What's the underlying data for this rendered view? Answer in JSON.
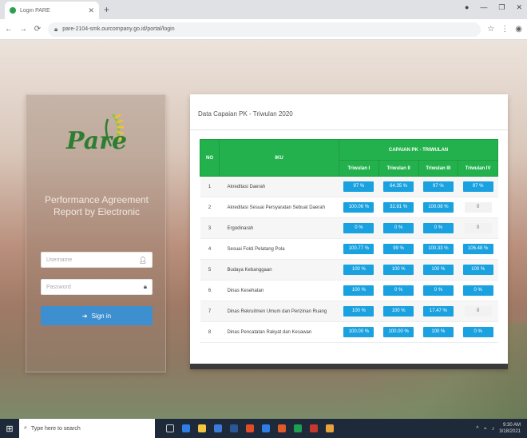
{
  "browser": {
    "tab_title": "Login PARE",
    "url": "pare-2104-smk.ourcompany.go.id/portal/login"
  },
  "login": {
    "logo_text": "Pare",
    "tagline": "Performance Agreement Report by Electronic",
    "username_placeholder": "Username",
    "password_placeholder": "Password",
    "signin_label": "Sign in"
  },
  "data": {
    "title": "Data Capaian PK - Triwulan 2020",
    "headers": {
      "no": "NO",
      "indicator": "IKU",
      "group": "CAPAIAN PK - TRIWULAN",
      "quarters": [
        "Triwulan I",
        "Triwulan II",
        "Triwulan III",
        "Triwulan IV"
      ]
    },
    "rows": [
      {
        "no": "1",
        "indicator": "Akreditasi Daerah",
        "q": [
          "97 %",
          "64.35 %",
          "97 %",
          "97 %"
        ]
      },
      {
        "no": "2",
        "indicator": "Akreditasi Sesuai Persyaratan Sebuat Daerah",
        "q": [
          "100.06 %",
          "32.81 %",
          "100.08 %",
          "0"
        ]
      },
      {
        "no": "3",
        "indicator": "Ergodinarah",
        "q": [
          "0 %",
          "0 %",
          "0 %",
          "0"
        ]
      },
      {
        "no": "4",
        "indicator": "Sesuai Fokti Pelatang Pola",
        "q": [
          "100.77 %",
          "99 %",
          "100.33 %",
          "106.48 %"
        ]
      },
      {
        "no": "5",
        "indicator": "Budaya Kebanggaan",
        "q": [
          "100 %",
          "100 %",
          "100 %",
          "100 %"
        ]
      },
      {
        "no": "6",
        "indicator": "Dinas Kesehatan",
        "q": [
          "100 %",
          "0 %",
          "0 %",
          "0 %"
        ]
      },
      {
        "no": "7",
        "indicator": "Dinas Rekruitmen Umum dan Perizinan Ruang",
        "q": [
          "100 %",
          "100 %",
          "17.47 %",
          "0"
        ]
      },
      {
        "no": "8",
        "indicator": "Dinas Pencatatan Rakyat dan Kesawan",
        "q": [
          "100.00 %",
          "100.00 %",
          "100 %",
          "0 %"
        ]
      }
    ]
  },
  "taskbar": {
    "search_placeholder": "Type here to search",
    "time": "9:30 AM",
    "date": "3/18/2021"
  }
}
